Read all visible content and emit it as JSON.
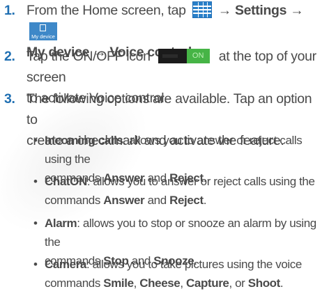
{
  "steps": [
    {
      "number": "1.",
      "line1_text": "From the Home screen, tap",
      "arrow1": "→",
      "settings": "Settings",
      "arrow2": "→",
      "my_device_icon_label": "My device",
      "line2_bold1": "My device",
      "arrow3": "→",
      "line2_bold2": "Voice control",
      "line2_end": "."
    },
    {
      "number": "2.",
      "text_before": "Tap the ON/OFF icon",
      "toggle_label": "ON",
      "text_after": "at the top of your screen",
      "line2": "to activate Voice control."
    },
    {
      "number": "3.",
      "line1": "The following options are available. Tap an option to",
      "line2": "create a checkmark and activate the feature."
    }
  ],
  "bullets": [
    {
      "dot": "•",
      "term": "Incoming calls",
      "desc": ": allows you to answer or reject calls using the",
      "cont_prefix": "commands ",
      "cmd1": "Answer",
      "joiner": " and ",
      "cmd2": "Reject",
      "end": "."
    },
    {
      "dot": "•",
      "term": "ChatON",
      "desc": ": allows you to answer or reject calls using the",
      "cont_prefix": "commands ",
      "cmd1": "Answer",
      "joiner": " and ",
      "cmd2": "Reject",
      "end": "."
    },
    {
      "dot": "•",
      "term": "Alarm",
      "desc": ": allows you to stop or snooze an alarm by using the",
      "cont_prefix": "commands ",
      "cmd1": "Stop",
      "joiner": " and ",
      "cmd2": "Snooze",
      "end": "."
    },
    {
      "dot": "•",
      "term": "Camera",
      "desc": ": allows you to take pictures using the voice",
      "cont_prefix": "commands ",
      "cmd1": "Smile",
      "sep1": ", ",
      "cmd2": "Cheese",
      "sep2": ", ",
      "cmd3": "Capture",
      "sep3": ", or ",
      "cmd4": "Shoot",
      "end": "."
    }
  ],
  "colors": {
    "step_number": "#1f6fb2",
    "text": "#4a4a4a",
    "apps_icon": "#2a80c9",
    "toggle_on": "#46b446"
  },
  "icons": [
    "apps-grid-icon",
    "my-device-icon",
    "on-off-toggle-icon"
  ]
}
